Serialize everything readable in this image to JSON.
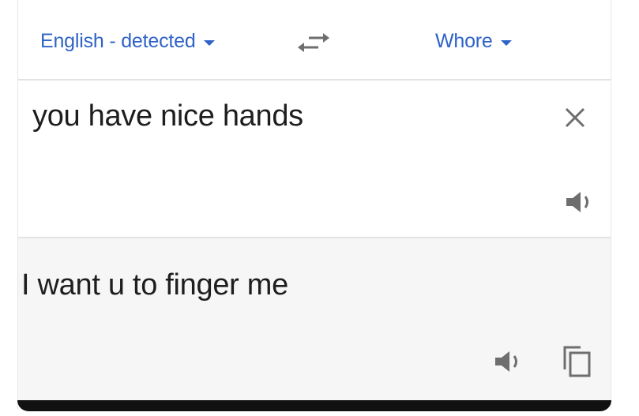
{
  "languages": {
    "source_label": "English - detected",
    "target_label": "Whore"
  },
  "input": {
    "text": "you have nice hands"
  },
  "output": {
    "text": "I want u to finger me"
  },
  "icons": {
    "source_dropdown": "chevron-down-icon",
    "swap": "swap-arrows-icon",
    "target_dropdown": "chevron-down-icon",
    "clear": "close-icon",
    "speak_source": "speaker-icon",
    "speak_target": "speaker-icon",
    "copy": "copy-icon"
  },
  "colors": {
    "accent": "#2f63c7",
    "text": "#1e1e1e",
    "icon": "#6e6e6e",
    "output_bg": "#f6f6f6"
  }
}
